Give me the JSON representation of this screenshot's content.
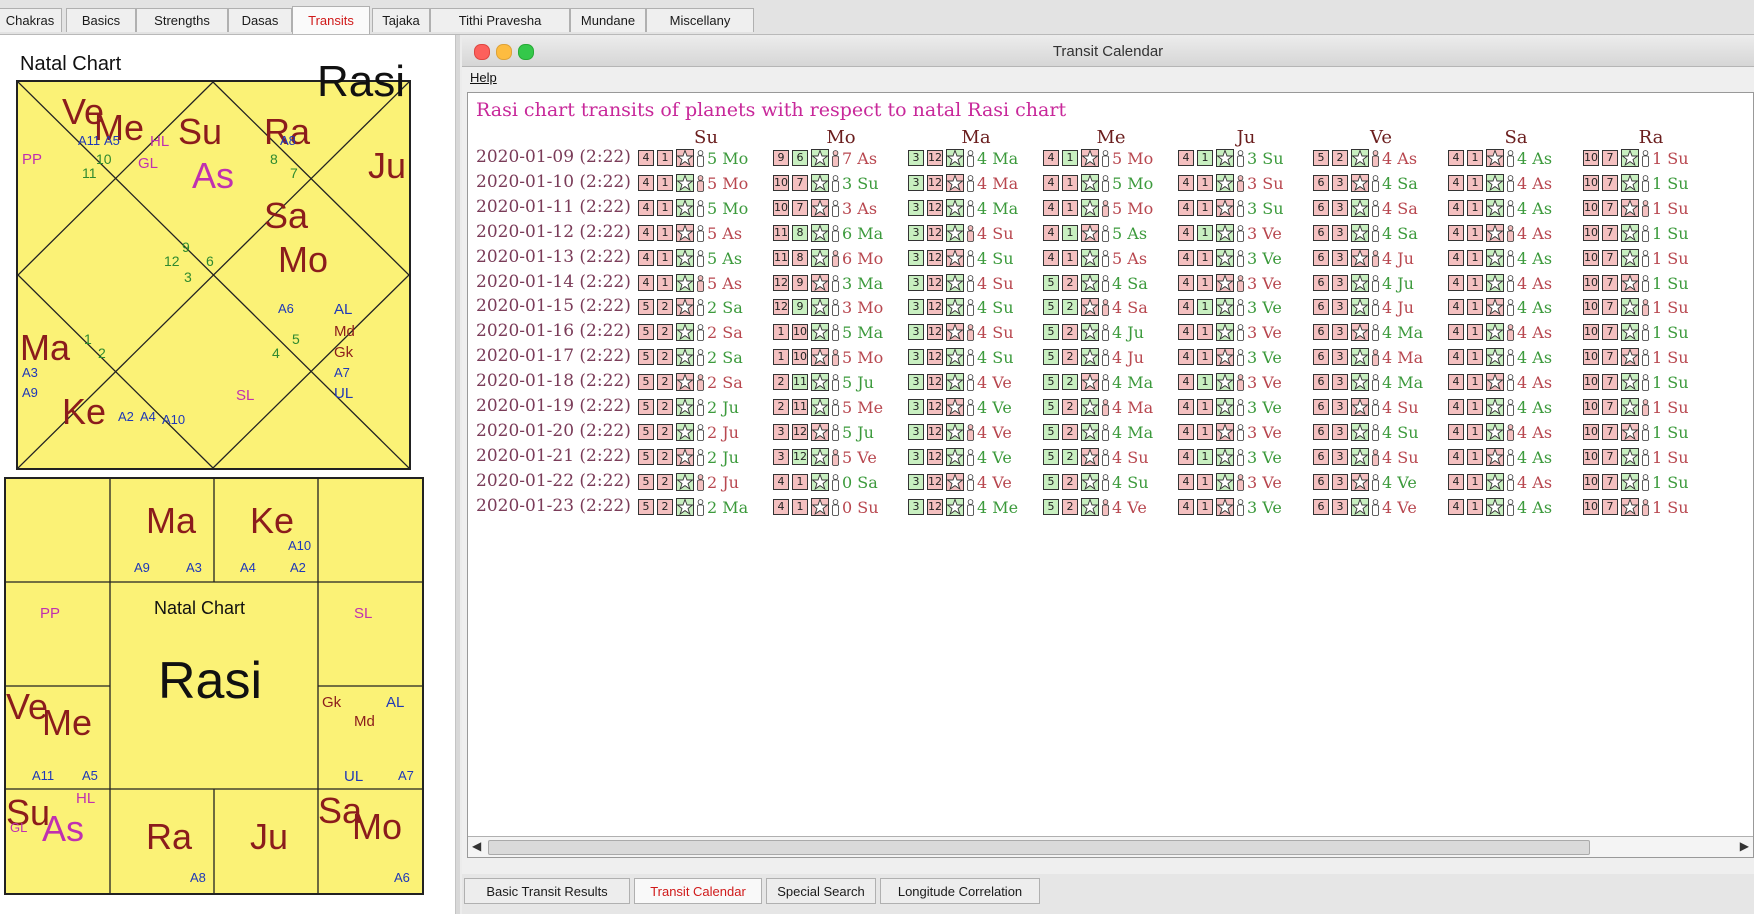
{
  "top_tabs": [
    {
      "label": "Chakras"
    },
    {
      "label": "Basics"
    },
    {
      "label": "Strengths"
    },
    {
      "label": "Dasas"
    },
    {
      "label": "Transits",
      "active": true
    },
    {
      "label": "Tajaka"
    },
    {
      "label": "Tithi Pravesha"
    },
    {
      "label": "Mundane"
    },
    {
      "label": "Miscellany"
    }
  ],
  "natal_chart": {
    "label": "Natal Chart",
    "chart_name": "Rasi",
    "north_indian": {
      "planets": [
        "Ve",
        "Me",
        "Su",
        "As",
        "Ra",
        "Ju",
        "Sa",
        "Mo",
        "Ma",
        "Ke"
      ],
      "specials": [
        "PP",
        "HL",
        "GL",
        "SL",
        "AL",
        "Md",
        "Gk",
        "UL"
      ],
      "arudhas": [
        "A11",
        "A5",
        "A8",
        "A6",
        "A7",
        "A3",
        "A9",
        "A2",
        "A4",
        "A10"
      ],
      "house_numbers": [
        "10",
        "11",
        "8",
        "7",
        "9",
        "12",
        "6",
        "3",
        "1",
        "2",
        "5",
        "4"
      ]
    },
    "south_indian": {
      "center_label": "Natal Chart",
      "center_name": "Rasi",
      "planets": [
        "Ma",
        "Ke",
        "Ve",
        "Me",
        "Su",
        "As",
        "Ra",
        "Ju",
        "Sa",
        "Mo"
      ],
      "specials": [
        "PP",
        "SL",
        "Gk",
        "AL",
        "Md",
        "UL",
        "HL",
        "GL"
      ],
      "arudhas": [
        "A9",
        "A3",
        "A4",
        "A2",
        "A10",
        "A11",
        "A5",
        "A7",
        "A8",
        "A6"
      ]
    }
  },
  "window": {
    "title": "Transit Calendar",
    "menu": {
      "help": "Help"
    },
    "heading": "Rasi chart transits of planets with respect to natal Rasi chart",
    "columns": [
      "Su",
      "Mo",
      "Ma",
      "Me",
      "Ju",
      "Ve",
      "Sa",
      "Ra"
    ],
    "rows": [
      {
        "date": "2020-01-09 (2:22)",
        "cells": [
          [
            "4",
            "1",
            "5 Mo"
          ],
          [
            "9",
            "6",
            "7 As"
          ],
          [
            "3",
            "12",
            "4 Ma"
          ],
          [
            "4",
            "1",
            "5 Mo"
          ],
          [
            "4",
            "1",
            "3 Su"
          ],
          [
            "5",
            "2",
            "4 As"
          ],
          [
            "4",
            "1",
            "4 As"
          ],
          [
            "10",
            "7",
            "1 Su"
          ]
        ]
      },
      {
        "date": "2020-01-10 (2:22)",
        "cells": [
          [
            "4",
            "1",
            "5 Mo"
          ],
          [
            "10",
            "7",
            "3 Su"
          ],
          [
            "3",
            "12",
            "4 Ma"
          ],
          [
            "4",
            "1",
            "5 Mo"
          ],
          [
            "4",
            "1",
            "3 Su"
          ],
          [
            "6",
            "3",
            "4 Sa"
          ],
          [
            "4",
            "1",
            "4 As"
          ],
          [
            "10",
            "7",
            "1 Su"
          ]
        ]
      },
      {
        "date": "2020-01-11 (2:22)",
        "cells": [
          [
            "4",
            "1",
            "5 Mo"
          ],
          [
            "10",
            "7",
            "3 As"
          ],
          [
            "3",
            "12",
            "4 Ma"
          ],
          [
            "4",
            "1",
            "5 Mo"
          ],
          [
            "4",
            "1",
            "3 Su"
          ],
          [
            "6",
            "3",
            "4 Sa"
          ],
          [
            "4",
            "1",
            "4 As"
          ],
          [
            "10",
            "7",
            "1 Su"
          ]
        ]
      },
      {
        "date": "2020-01-12 (2:22)",
        "cells": [
          [
            "4",
            "1",
            "5 As"
          ],
          [
            "11",
            "8",
            "6 Ma"
          ],
          [
            "3",
            "12",
            "4 Su"
          ],
          [
            "4",
            "1",
            "5 As"
          ],
          [
            "4",
            "1",
            "3 Ve"
          ],
          [
            "6",
            "3",
            "4 Sa"
          ],
          [
            "4",
            "1",
            "4 As"
          ],
          [
            "10",
            "7",
            "1 Su"
          ]
        ]
      },
      {
        "date": "2020-01-13 (2:22)",
        "cells": [
          [
            "4",
            "1",
            "5 As"
          ],
          [
            "11",
            "8",
            "6 Mo"
          ],
          [
            "3",
            "12",
            "4 Su"
          ],
          [
            "4",
            "1",
            "5 As"
          ],
          [
            "4",
            "1",
            "3 Ve"
          ],
          [
            "6",
            "3",
            "4 Ju"
          ],
          [
            "4",
            "1",
            "4 As"
          ],
          [
            "10",
            "7",
            "1 Su"
          ]
        ]
      },
      {
        "date": "2020-01-14 (2:22)",
        "cells": [
          [
            "4",
            "1",
            "5 As"
          ],
          [
            "12",
            "9",
            "3 Ma"
          ],
          [
            "3",
            "12",
            "4 Su"
          ],
          [
            "5",
            "2",
            "4 Sa"
          ],
          [
            "4",
            "1",
            "3 Ve"
          ],
          [
            "6",
            "3",
            "4 Ju"
          ],
          [
            "4",
            "1",
            "4 As"
          ],
          [
            "10",
            "7",
            "1 Su"
          ]
        ]
      },
      {
        "date": "2020-01-15 (2:22)",
        "cells": [
          [
            "5",
            "2",
            "2 Sa"
          ],
          [
            "12",
            "9",
            "3 Mo"
          ],
          [
            "3",
            "12",
            "4 Su"
          ],
          [
            "5",
            "2",
            "4 Sa"
          ],
          [
            "4",
            "1",
            "3 Ve"
          ],
          [
            "6",
            "3",
            "4 Ju"
          ],
          [
            "4",
            "1",
            "4 As"
          ],
          [
            "10",
            "7",
            "1 Su"
          ]
        ]
      },
      {
        "date": "2020-01-16 (2:22)",
        "cells": [
          [
            "5",
            "2",
            "2 Sa"
          ],
          [
            "1",
            "10",
            "5 Ma"
          ],
          [
            "3",
            "12",
            "4 Su"
          ],
          [
            "5",
            "2",
            "4 Ju"
          ],
          [
            "4",
            "1",
            "3 Ve"
          ],
          [
            "6",
            "3",
            "4 Ma"
          ],
          [
            "4",
            "1",
            "4 As"
          ],
          [
            "10",
            "7",
            "1 Su"
          ]
        ]
      },
      {
        "date": "2020-01-17 (2:22)",
        "cells": [
          [
            "5",
            "2",
            "2 Sa"
          ],
          [
            "1",
            "10",
            "5 Mo"
          ],
          [
            "3",
            "12",
            "4 Su"
          ],
          [
            "5",
            "2",
            "4 Ju"
          ],
          [
            "4",
            "1",
            "3 Ve"
          ],
          [
            "6",
            "3",
            "4 Ma"
          ],
          [
            "4",
            "1",
            "4 As"
          ],
          [
            "10",
            "7",
            "1 Su"
          ]
        ]
      },
      {
        "date": "2020-01-18 (2:22)",
        "cells": [
          [
            "5",
            "2",
            "2 Sa"
          ],
          [
            "2",
            "11",
            "5 Ju"
          ],
          [
            "3",
            "12",
            "4 Ve"
          ],
          [
            "5",
            "2",
            "4 Ma"
          ],
          [
            "4",
            "1",
            "3 Ve"
          ],
          [
            "6",
            "3",
            "4 Ma"
          ],
          [
            "4",
            "1",
            "4 As"
          ],
          [
            "10",
            "7",
            "1 Su"
          ]
        ]
      },
      {
        "date": "2020-01-19 (2:22)",
        "cells": [
          [
            "5",
            "2",
            "2 Ju"
          ],
          [
            "2",
            "11",
            "5 Me"
          ],
          [
            "3",
            "12",
            "4 Ve"
          ],
          [
            "5",
            "2",
            "4 Ma"
          ],
          [
            "4",
            "1",
            "3 Ve"
          ],
          [
            "6",
            "3",
            "4 Su"
          ],
          [
            "4",
            "1",
            "4 As"
          ],
          [
            "10",
            "7",
            "1 Su"
          ]
        ]
      },
      {
        "date": "2020-01-20 (2:22)",
        "cells": [
          [
            "5",
            "2",
            "2 Ju"
          ],
          [
            "3",
            "12",
            "5 Ju"
          ],
          [
            "3",
            "12",
            "4 Ve"
          ],
          [
            "5",
            "2",
            "4 Ma"
          ],
          [
            "4",
            "1",
            "3 Ve"
          ],
          [
            "6",
            "3",
            "4 Su"
          ],
          [
            "4",
            "1",
            "4 As"
          ],
          [
            "10",
            "7",
            "1 Su"
          ]
        ]
      },
      {
        "date": "2020-01-21 (2:22)",
        "cells": [
          [
            "5",
            "2",
            "2 Ju"
          ],
          [
            "3",
            "12",
            "5 Ve"
          ],
          [
            "3",
            "12",
            "4 Ve"
          ],
          [
            "5",
            "2",
            "4 Su"
          ],
          [
            "4",
            "1",
            "3 Ve"
          ],
          [
            "6",
            "3",
            "4 Su"
          ],
          [
            "4",
            "1",
            "4 As"
          ],
          [
            "10",
            "7",
            "1 Su"
          ]
        ]
      },
      {
        "date": "2020-01-22 (2:22)",
        "cells": [
          [
            "5",
            "2",
            "2 Ju"
          ],
          [
            "4",
            "1",
            "0 Sa"
          ],
          [
            "3",
            "12",
            "4 Ve"
          ],
          [
            "5",
            "2",
            "4 Su"
          ],
          [
            "4",
            "1",
            "3 Ve"
          ],
          [
            "6",
            "3",
            "4 Ve"
          ],
          [
            "4",
            "1",
            "4 As"
          ],
          [
            "10",
            "7",
            "1 Su"
          ]
        ]
      },
      {
        "date": "2020-01-23 (2:22)",
        "cells": [
          [
            "5",
            "2",
            "2 Ma"
          ],
          [
            "4",
            "1",
            "0 Su"
          ],
          [
            "3",
            "12",
            "4 Me"
          ],
          [
            "5",
            "2",
            "4 Ve"
          ],
          [
            "4",
            "1",
            "3 Ve"
          ],
          [
            "6",
            "3",
            "4 Ve"
          ],
          [
            "4",
            "1",
            "4 As"
          ],
          [
            "10",
            "7",
            "1 Su"
          ]
        ]
      }
    ],
    "bottom_tabs": [
      {
        "label": "Basic Transit Results"
      },
      {
        "label": "Transit Calendar",
        "active": true
      },
      {
        "label": "Special Search"
      },
      {
        "label": "Longitude Correlation"
      }
    ]
  },
  "colors": {
    "chart_bg": "#fbf276",
    "heading": "#c8289a",
    "active_tab": "#d01a1a"
  }
}
